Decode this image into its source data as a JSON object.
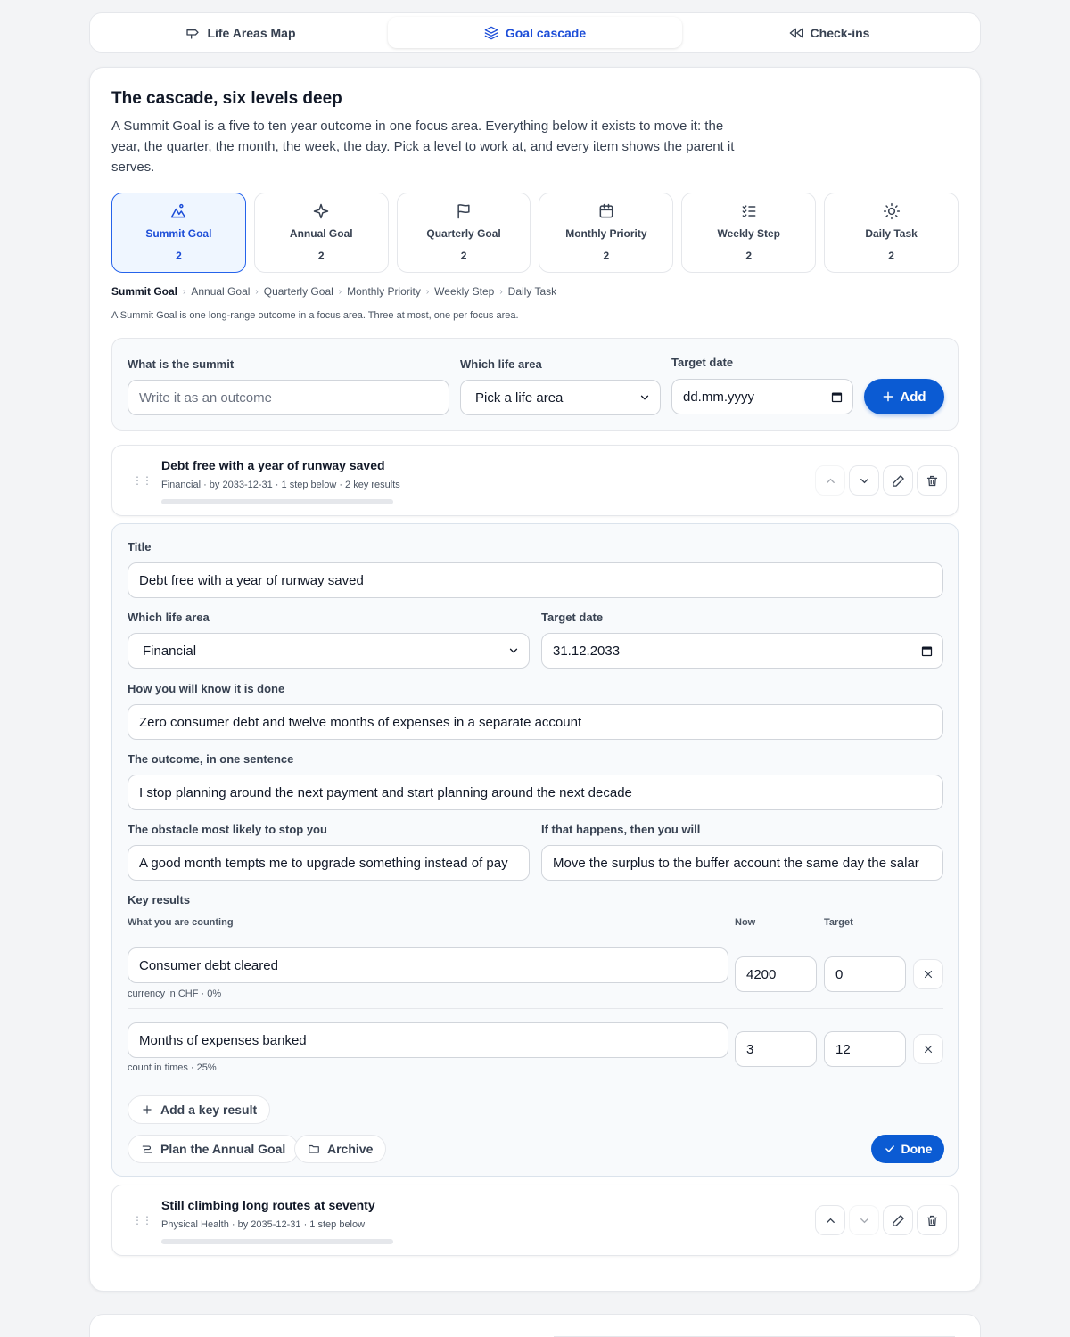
{
  "tabs": [
    {
      "label": "Life Areas Map",
      "icon": "signpost-icon"
    },
    {
      "label": "Goal cascade",
      "icon": "layers-icon"
    },
    {
      "label": "Check-ins",
      "icon": "rewind-icon"
    }
  ],
  "heading": "The cascade, six levels deep",
  "intro": "A Summit Goal is a five to ten year outcome in one focus area. Everything below it exists to move it: the year, the quarter, the month, the week, the day. Pick a level to work at, and every item shows the parent it serves.",
  "levels": [
    {
      "label": "Summit Goal",
      "count": "2",
      "icon": "mountain-icon"
    },
    {
      "label": "Annual Goal",
      "count": "2",
      "icon": "sparkle-icon"
    },
    {
      "label": "Quarterly Goal",
      "count": "2",
      "icon": "flag-icon"
    },
    {
      "label": "Monthly Priority",
      "count": "2",
      "icon": "calendar-icon"
    },
    {
      "label": "Weekly Step",
      "count": "2",
      "icon": "checklist-icon"
    },
    {
      "label": "Daily Task",
      "count": "2",
      "icon": "sun-icon"
    }
  ],
  "breadcrumb": [
    "Summit Goal",
    "Annual Goal",
    "Quarterly Goal",
    "Monthly Priority",
    "Weekly Step",
    "Daily Task"
  ],
  "level_hint": "A Summit Goal is one long-range outcome in a focus area. Three at most, one per focus area.",
  "add_form": {
    "summit_label": "What is the summit",
    "summit_placeholder": "Write it as an outcome",
    "area_label": "Which life area",
    "area_value": "Pick a life area",
    "date_label": "Target date",
    "date_value": "dd.mm.yyyy",
    "add_button": "Add"
  },
  "items": [
    {
      "title": "Debt free with a year of runway saved",
      "meta": "Financial · by 2033-12-31 · 1 step below · 2 key results",
      "progress": 0
    },
    {
      "title": "Still climbing long routes at seventy",
      "meta": "Physical Health · by 2035-12-31 · 1 step below",
      "progress": 0
    }
  ],
  "editor": {
    "title_label": "Title",
    "title_value": "Debt free with a year of runway saved",
    "area_label": "Which life area",
    "area_value": "Financial",
    "date_label": "Target date",
    "date_value": "31.12.2033",
    "done_label": "How you will know it is done",
    "done_value": "Zero consumer debt and twelve months of expenses in a separate account",
    "outcome_label": "The outcome, in one sentence",
    "outcome_value": "I stop planning around the next payment and start planning around the next decade",
    "obstacle_label": "The obstacle most likely to stop you",
    "obstacle_value": "A good month tempts me to upgrade something instead of pay",
    "ifthen_label": "If that happens, then you will",
    "ifthen_value": "Move the surplus to the buffer account the same day the salar",
    "kr_label": "Key results",
    "kr_col_what": "What you are counting",
    "kr_col_now": "Now",
    "kr_col_target": "Target",
    "key_results": [
      {
        "name": "Consumer debt cleared",
        "now": "4200",
        "target": "0",
        "note": "currency in CHF · 0%"
      },
      {
        "name": "Months of expenses banked",
        "now": "3",
        "target": "12",
        "note": "count in times · 25%"
      }
    ],
    "add_kr": "Add a key result",
    "plan_button": "Plan the Annual Goal",
    "archive_button": "Archive",
    "done_button": "Done"
  },
  "colors": {
    "accent": "#0b5bd3",
    "active_bg": "#eff6ff"
  }
}
